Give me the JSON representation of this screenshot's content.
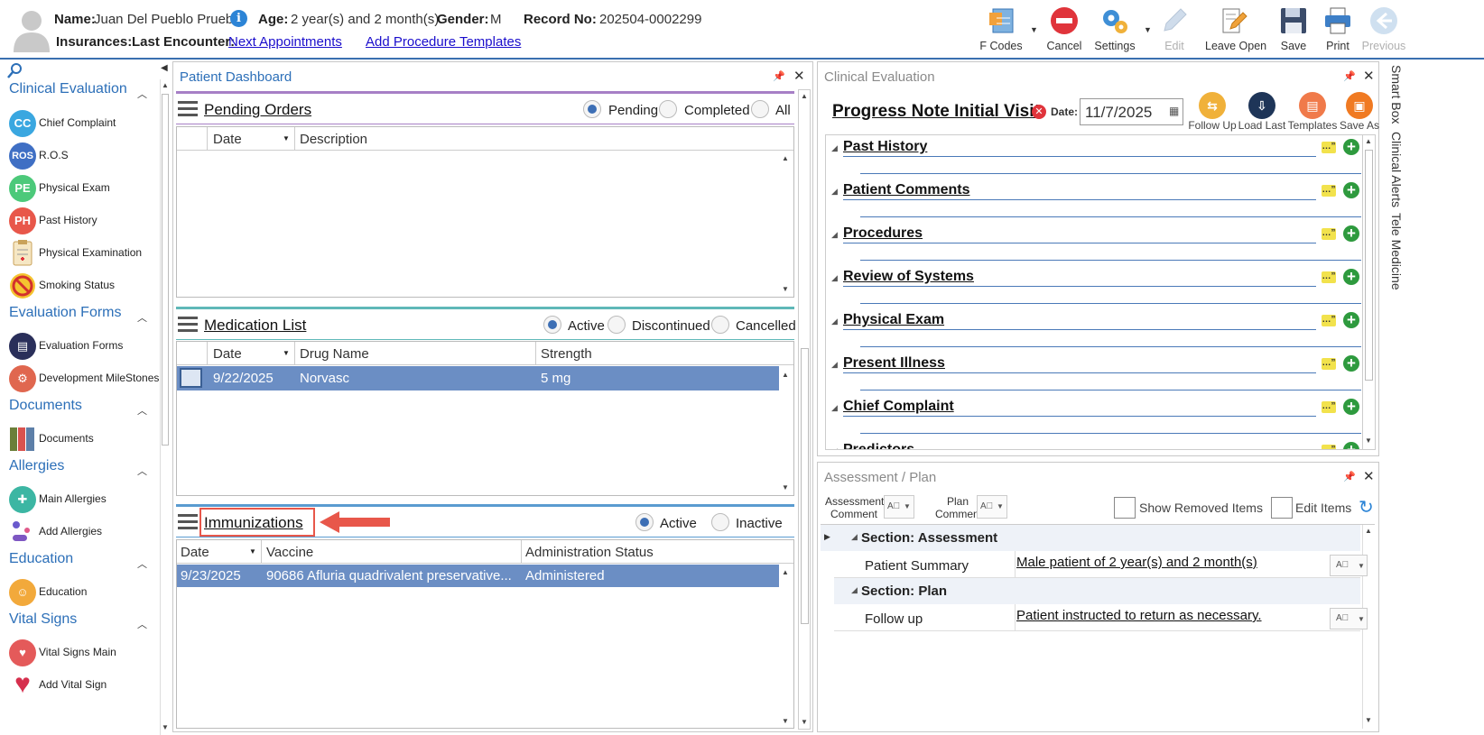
{
  "header": {
    "name_label": "Name:",
    "name_value": "Juan Del Pueblo Prueba",
    "age_label": "Age:",
    "age_value": "2 year(s) and 2 month(s)",
    "gender_label": "Gender:",
    "gender_value": "M",
    "record_label": "Record No:",
    "record_value": "202504-0002299",
    "insurances_label": "Insurances:",
    "last_encounter_label": "Last Encounter:",
    "next_appointments": "Next Appointments",
    "add_procedure_templates": "Add Procedure Templates"
  },
  "toolbar": {
    "fcodes": "F Codes",
    "cancel": "Cancel",
    "settings": "Settings",
    "edit": "Edit",
    "leave_open": "Leave Open",
    "save": "Save",
    "print": "Print",
    "previous": "Previous"
  },
  "sidebar": {
    "sections": [
      {
        "title": "Clinical Evaluation",
        "items": [
          {
            "label": "Chief Complaint",
            "icon": "CC"
          },
          {
            "label": "R.O.S",
            "icon": "ROS"
          },
          {
            "label": "Physical Exam",
            "icon": "PE"
          },
          {
            "label": "Past History",
            "icon": "PH"
          },
          {
            "label": "Physical Examination",
            "icon": "clipboard-icon"
          },
          {
            "label": "Smoking Status",
            "icon": "no-smoking-icon"
          }
        ]
      },
      {
        "title": "Evaluation Forms",
        "items": [
          {
            "label": "Evaluation Forms",
            "icon": "form-icon"
          },
          {
            "label": "Development MileStones",
            "icon": "milestones-icon"
          }
        ]
      },
      {
        "title": "Documents",
        "items": [
          {
            "label": "Documents",
            "icon": "binders-icon"
          }
        ]
      },
      {
        "title": "Allergies",
        "items": [
          {
            "label": "Main Allergies",
            "icon": "allergy-icon"
          },
          {
            "label": "Add Allergies",
            "icon": "pills-icon"
          }
        ]
      },
      {
        "title": "Education",
        "items": [
          {
            "label": "Education",
            "icon": "education-icon"
          }
        ]
      },
      {
        "title": "Vital Signs",
        "items": [
          {
            "label": "Vital Signs Main",
            "icon": "heart-monitor-icon"
          },
          {
            "label": "Add Vital Sign",
            "icon": "heart-plus-icon"
          }
        ]
      }
    ]
  },
  "dashboard": {
    "title": "Patient Dashboard",
    "pending_orders": {
      "title": "Pending Orders",
      "filters": [
        "Pending",
        "Completed",
        "All"
      ],
      "selected": "Pending",
      "columns": [
        "Date",
        "Description"
      ]
    },
    "medication_list": {
      "title": "Medication List",
      "filters": [
        "Active",
        "Discontinued",
        "Cancelled"
      ],
      "selected": "Active",
      "columns": [
        "Date",
        "Drug Name",
        "Strength"
      ],
      "rows": [
        {
          "date": "9/22/2025",
          "drug": "Norvasc",
          "strength": "5 mg"
        }
      ]
    },
    "immunizations": {
      "title": "Immunizations",
      "filters": [
        "Active",
        "Inactive"
      ],
      "selected": "Active",
      "columns": [
        "Date",
        "Vaccine",
        "Administration Status"
      ],
      "rows": [
        {
          "date": "9/23/2025",
          "vaccine": "90686 Afluria quadrivalent preservative...",
          "status": "Administered"
        }
      ]
    }
  },
  "clinical_eval": {
    "panel_title": "Clinical Evaluation",
    "note_title": "Progress Note Initial Visit",
    "date_label": "Date:",
    "date_value": "11/7/2025",
    "actions": [
      "Follow Up",
      "Load Last",
      "Templates",
      "Save As"
    ],
    "sections": [
      "Past History",
      "Patient Comments",
      "Procedures",
      "Review of Systems",
      "Physical Exam",
      "Present Illness",
      "Chief Complaint",
      "Predictors"
    ]
  },
  "assessment": {
    "panel_title": "Assessment / Plan",
    "assessment_comment": "Assessment Comment",
    "plan_comment": "Plan Comment",
    "show_removed": "Show Removed Items",
    "edit_items": "Edit Items",
    "section_assessment": "Section: Assessment",
    "patient_summary_label": "Patient Summary",
    "patient_summary_value": "Male patient of 2 year(s) and 2 month(s)",
    "section_plan": "Section: Plan",
    "follow_up_label": "Follow up",
    "follow_up_value": "Patient instructed to return as necessary."
  },
  "right_tabs": [
    "Smart Box",
    "Clinical Alerts",
    "Tele Medicine"
  ],
  "colors": {
    "accent": "#2c6fb8",
    "selected_row": "#6b8ec4",
    "purple_bar": "#a77fc6",
    "teal_bar": "#5fb8b8",
    "blue_bar": "#5a9bd0",
    "highlight_red": "#e8574a"
  }
}
